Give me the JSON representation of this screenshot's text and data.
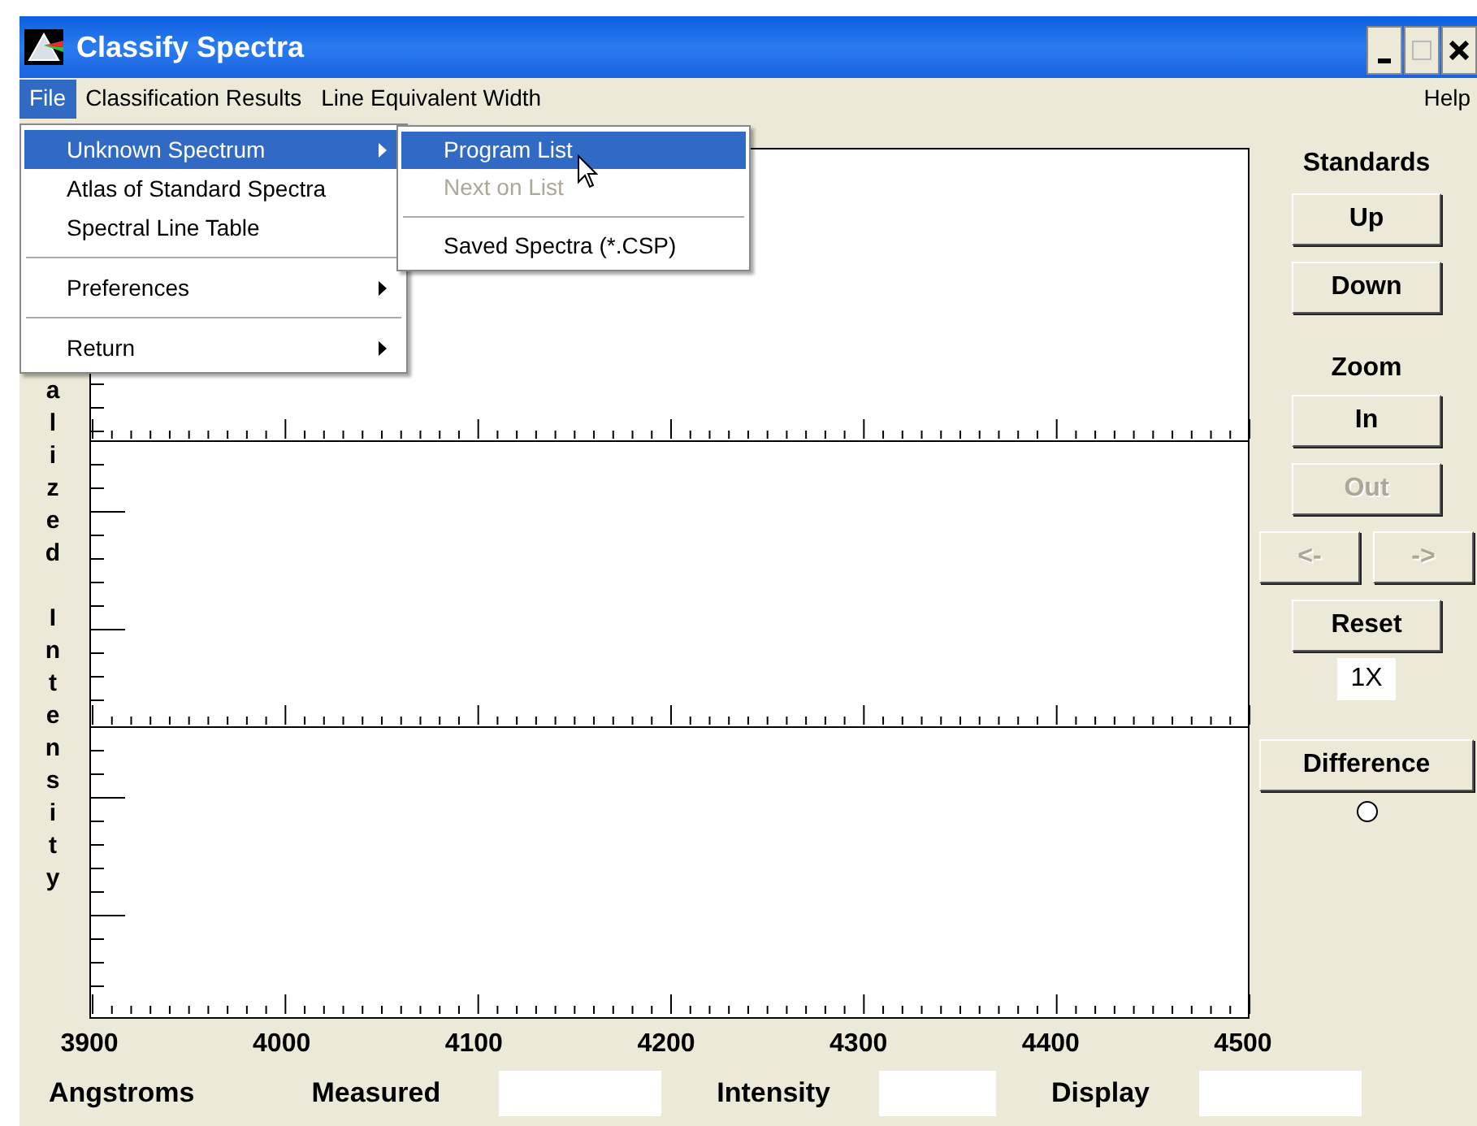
{
  "window": {
    "title": "Classify Spectra"
  },
  "menu_bar": {
    "items": [
      {
        "label": "File",
        "selected": true
      },
      {
        "label": "Classification Results",
        "selected": false
      },
      {
        "label": "Line Equivalent Width",
        "selected": false
      }
    ],
    "help": "Help"
  },
  "file_menu": [
    {
      "kind": "item",
      "label": "Unknown Spectrum",
      "selected": true,
      "submenu": true
    },
    {
      "kind": "item",
      "label": "Atlas of Standard Spectra",
      "selected": false,
      "submenu": false
    },
    {
      "kind": "item",
      "label": "Spectral Line Table",
      "selected": false,
      "submenu": false
    },
    {
      "kind": "separator"
    },
    {
      "kind": "item",
      "label": "Preferences",
      "selected": false,
      "submenu": true
    },
    {
      "kind": "separator"
    },
    {
      "kind": "item",
      "label": "Return",
      "selected": false,
      "submenu": true
    }
  ],
  "submenu": [
    {
      "kind": "item",
      "label": "Program List",
      "selected": true,
      "disabled": false
    },
    {
      "kind": "item",
      "label": "Next on List",
      "selected": false,
      "disabled": true
    },
    {
      "kind": "separator"
    },
    {
      "kind": "item",
      "label": "Saved Spectra (*.CSP)",
      "selected": false,
      "disabled": false
    }
  ],
  "plot": {
    "y_label": "alized Intensity",
    "x_tick_labels": [
      "3900",
      "4000",
      "4100",
      "4200",
      "4300",
      "4400",
      "4500"
    ]
  },
  "standards": {
    "label": "Standards",
    "buttons": [
      {
        "label": "Up",
        "disabled": false
      },
      {
        "label": "Down",
        "disabled": false
      }
    ]
  },
  "zoom": {
    "label": "Zoom",
    "buttons": [
      {
        "kind": "full",
        "label": "In",
        "disabled": false
      },
      {
        "kind": "full",
        "label": "Out",
        "disabled": true
      },
      {
        "kind": "pair",
        "items": [
          {
            "label": "<-",
            "disabled": true
          },
          {
            "label": "->",
            "disabled": true
          }
        ]
      },
      {
        "kind": "full",
        "label": "Reset",
        "disabled": false
      }
    ],
    "readout": "1X"
  },
  "difference": {
    "label": "Difference",
    "disabled": false,
    "radio_selected": false
  },
  "status_row": [
    {
      "kind": "label",
      "text": "Angstroms"
    },
    {
      "kind": "label",
      "text": "Measured"
    },
    {
      "kind": "field"
    },
    {
      "kind": "label",
      "text": "Intensity"
    },
    {
      "kind": "field"
    },
    {
      "kind": "label",
      "text": "Display"
    },
    {
      "kind": "field"
    }
  ]
}
